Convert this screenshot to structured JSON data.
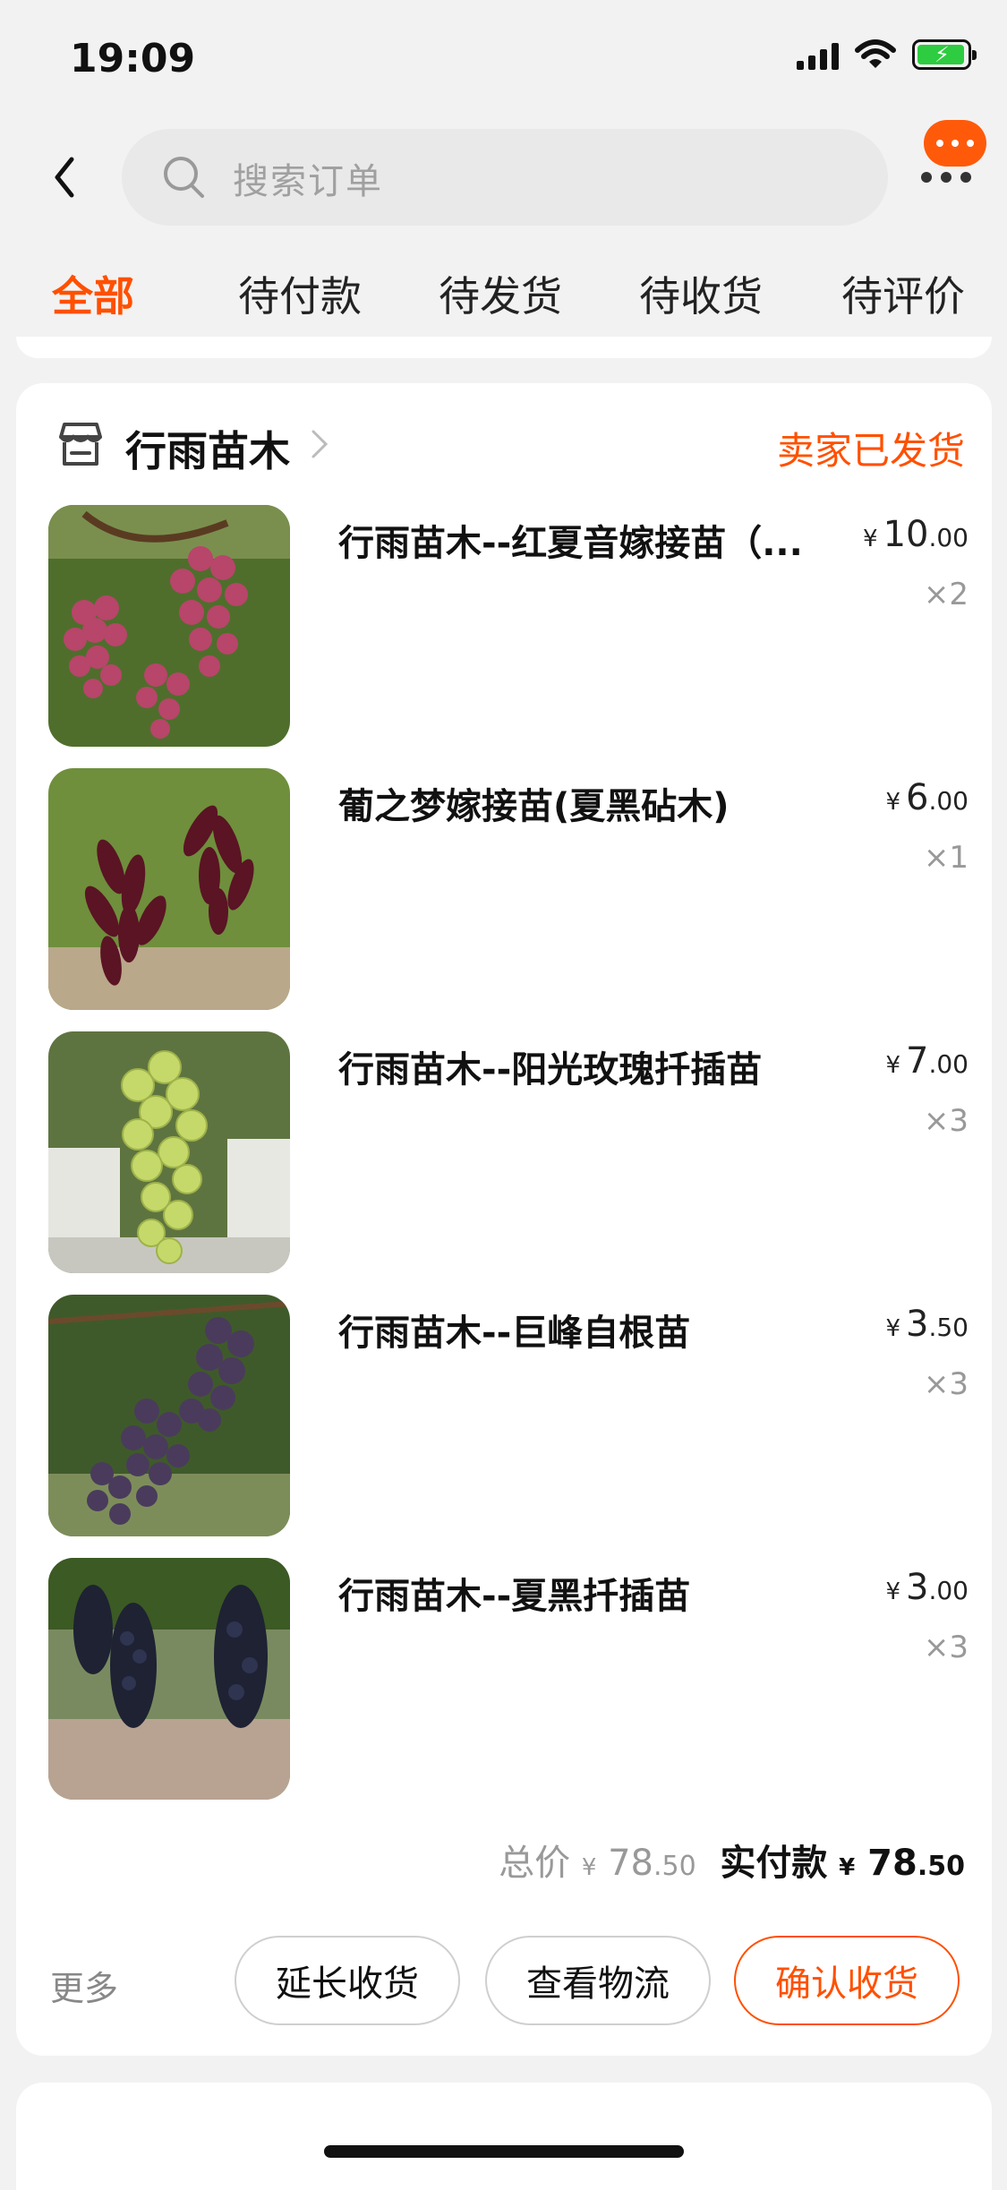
{
  "status_bar": {
    "time": "19:09"
  },
  "header": {
    "search_placeholder": "搜索订单"
  },
  "tabs": [
    {
      "label": "全部",
      "active": true
    },
    {
      "label": "待付款",
      "active": false
    },
    {
      "label": "待发货",
      "active": false
    },
    {
      "label": "待收货",
      "active": false
    },
    {
      "label": "待评价",
      "active": false
    }
  ],
  "order": {
    "shop_name": "行雨苗木",
    "status": "卖家已发货",
    "items": [
      {
        "title": "行雨苗木--红夏音嫁接苗（...",
        "currency": "¥",
        "price_int": "10",
        "price_dec": ".00",
        "qty": "×2"
      },
      {
        "title": "葡之梦嫁接苗(夏黑砧木)",
        "currency": "¥",
        "price_int": "6",
        "price_dec": ".00",
        "qty": "×1"
      },
      {
        "title": "行雨苗木--阳光玫瑰扦插苗",
        "currency": "¥",
        "price_int": "7",
        "price_dec": ".00",
        "qty": "×3"
      },
      {
        "title": "行雨苗木--巨峰自根苗",
        "currency": "¥",
        "price_int": "3",
        "price_dec": ".50",
        "qty": "×3"
      },
      {
        "title": "行雨苗木--夏黑扦插苗",
        "currency": "¥",
        "price_int": "3",
        "price_dec": ".00",
        "qty": "×3"
      }
    ],
    "totals": {
      "total_label": "总价",
      "total_currency": "¥",
      "total_int": "78",
      "total_dec": ".50",
      "paid_label": "实付款",
      "paid_currency": "¥",
      "paid_int": "78",
      "paid_dec": ".50"
    },
    "actions": {
      "more_label": "更多",
      "extend_label": "延长收货",
      "logistics_label": "查看物流",
      "confirm_label": "确认收货"
    }
  },
  "colors": {
    "accent": "#ff5000",
    "page_bg": "#f2f2f2",
    "card_bg": "#ffffff"
  }
}
